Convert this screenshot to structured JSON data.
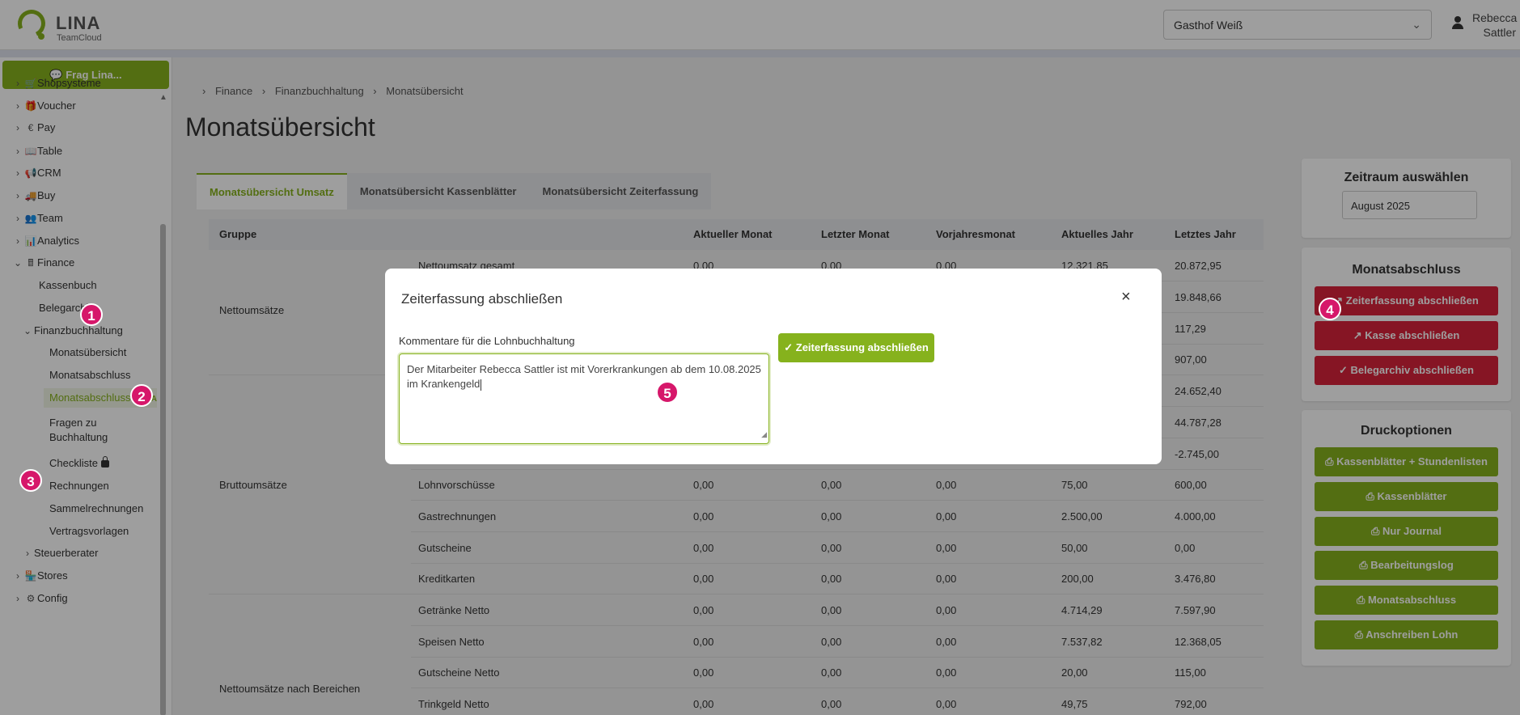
{
  "brand": {
    "name": "LINA",
    "sub": "TeamCloud"
  },
  "header": {
    "location": "Gasthof Weiß",
    "user_first": "Rebecca",
    "user_last": "Sattler"
  },
  "sidebar": {
    "ask_button": "Frag Lina...",
    "items": [
      {
        "label": "Shopsysteme"
      },
      {
        "label": "Voucher"
      },
      {
        "label": "Pay"
      },
      {
        "label": "Table"
      },
      {
        "label": "CRM"
      },
      {
        "label": "Buy"
      },
      {
        "label": "Team"
      },
      {
        "label": "Analytics"
      },
      {
        "label": "Finance"
      },
      {
        "label": "Kassenbuch"
      },
      {
        "label": "Belegarchiv"
      },
      {
        "label": "Finanzbuchhaltung"
      },
      {
        "label": "Monatsübersicht"
      },
      {
        "label": "Monatsabschluss"
      },
      {
        "label": "Monatsabschluss",
        "tag": "BETA"
      },
      {
        "label": "Fragen zu"
      },
      {
        "label": "Buchhaltung"
      },
      {
        "label": "Checkliste"
      },
      {
        "label": "Rechnungen"
      },
      {
        "label": "Sammelrechnungen"
      },
      {
        "label": "Vertragsvorlagen"
      },
      {
        "label": "Steuerberater"
      },
      {
        "label": "Stores"
      },
      {
        "label": "Config"
      }
    ]
  },
  "breadcrumb": [
    "Finance",
    "Finanzbuchhaltung",
    "Monatsübersicht"
  ],
  "page_title": "Monatsübersicht",
  "tabs": [
    "Monatsübersicht Umsatz",
    "Monatsübersicht Kassenblätter",
    "Monatsübersicht Zeiterfassung"
  ],
  "table": {
    "headers": [
      "Gruppe",
      "Aktueller Monat",
      "Letzter Monat",
      "Vorjahresmonat",
      "Aktuelles Jahr",
      "Letztes Jahr"
    ],
    "groups": [
      "Nettoumsätze",
      "Bruttoumsätze",
      "Nettoumsätze nach Bereichen"
    ],
    "rows": [
      {
        "label": "Nettoumsatz gesamt",
        "cells": [
          "0,00",
          "0,00",
          "0,00",
          "12.321,85",
          "20.872,95"
        ]
      },
      {
        "label": "",
        "cells": [
          "",
          "",
          "",
          "",
          "19.848,66"
        ]
      },
      {
        "label": "",
        "cells": [
          "",
          "",
          "",
          "",
          "117,29"
        ]
      },
      {
        "label": "",
        "cells": [
          "",
          "",
          "",
          "",
          "907,00"
        ]
      },
      {
        "label": "",
        "cells": [
          "",
          "",
          "",
          "",
          "24.652,40"
        ]
      },
      {
        "label": "",
        "cells": [
          "",
          "",
          "",
          "",
          "44.787,28"
        ]
      },
      {
        "label": "",
        "cells": [
          "",
          "",
          "",
          "",
          "-2.745,00"
        ]
      },
      {
        "label": "Lohnvorschüsse",
        "cells": [
          "0,00",
          "0,00",
          "0,00",
          "75,00",
          "600,00"
        ]
      },
      {
        "label": "Gastrechnungen",
        "cells": [
          "0,00",
          "0,00",
          "0,00",
          "2.500,00",
          "4.000,00"
        ]
      },
      {
        "label": "Gutscheine",
        "cells": [
          "0,00",
          "0,00",
          "0,00",
          "50,00",
          "0,00"
        ]
      },
      {
        "label": "Kreditkarten",
        "cells": [
          "0,00",
          "0,00",
          "0,00",
          "200,00",
          "3.476,80"
        ]
      },
      {
        "label": "Getränke Netto",
        "cells": [
          "0,00",
          "0,00",
          "0,00",
          "4.714,29",
          "7.597,90"
        ]
      },
      {
        "label": "Speisen Netto",
        "cells": [
          "0,00",
          "0,00",
          "0,00",
          "7.537,82",
          "12.368,05"
        ]
      },
      {
        "label": "Gutscheine Netto",
        "cells": [
          "0,00",
          "0,00",
          "0,00",
          "20,00",
          "115,00"
        ]
      },
      {
        "label": "Trinkgeld Netto",
        "cells": [
          "0,00",
          "0,00",
          "0,00",
          "49,75",
          "792,00"
        ]
      }
    ]
  },
  "right": {
    "period_title": "Zeitraum auswählen",
    "period_value": "August 2025",
    "close_title": "Monatsabschluss",
    "close_buttons": [
      "Zeiterfassung abschließen",
      "Kasse abschließen",
      "Belegarchiv abschließen"
    ],
    "print_title": "Druckoptionen",
    "print_buttons": [
      "Kassenblätter + Stundenlisten",
      "Kassenblätter",
      "Nur Journal",
      "Bearbeitungslog",
      "Monatsabschluss",
      "Anschreiben Lohn"
    ]
  },
  "modal": {
    "title": "Zeiterfassung abschließen",
    "label": "Kommentare für die Lohnbuchhaltung",
    "comment_line1": "Der Mitarbeiter Rebecca Sattler ist mit Vorerkrankungen ab dem 10.08.2025",
    "comment_line2": "im Krankengeld",
    "submit": "Zeiterfassung abschließen"
  },
  "badges": [
    "1",
    "2",
    "3",
    "4",
    "5"
  ],
  "colors": {
    "accent": "#86b21d",
    "danger": "#d9223a",
    "badge": "#d6176a"
  }
}
